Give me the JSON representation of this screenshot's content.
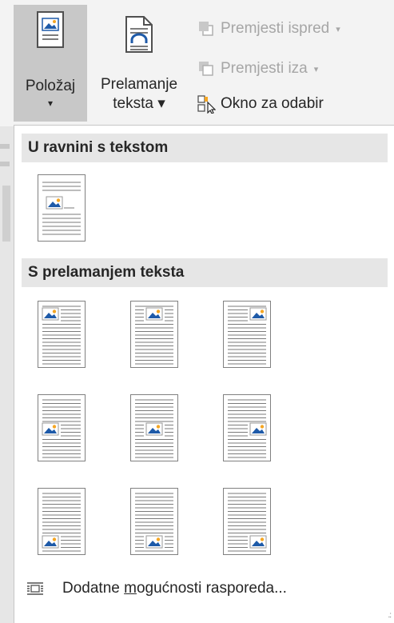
{
  "ribbon": {
    "position_button": {
      "line1": "Položaj",
      "line2": "▾"
    },
    "wrap_button": {
      "line1": "Prelamanje",
      "line2": "teksta ▾"
    },
    "bring_forward": {
      "label": "Premjesti ispred",
      "caret": "▾"
    },
    "send_backward": {
      "label": "Premjesti iza",
      "caret": "▾"
    },
    "selection_pane": {
      "label": "Okno za odabir"
    }
  },
  "dropdown": {
    "inline_header": "U ravnini s tekstom",
    "wrap_header": "S prelamanjem teksta",
    "footer_prefix": "Dodatne ",
    "footer_accel": "m",
    "footer_suffix": "ogućnosti rasporeda...",
    "grip": ".:"
  },
  "colors": {
    "ribbon_bg": "#f3f3f3",
    "selected_button_bg": "#c8c8c8",
    "section_header_bg": "#e6e6e6",
    "image_blue": "#1e5aa8",
    "image_sun": "#f5a623"
  },
  "icons": {
    "position": "position-icon",
    "wrap_text": "wrap-text-icon",
    "bring_forward": "bring-forward-icon",
    "send_backward": "send-backward-icon",
    "selection_pane": "selection-pane-icon",
    "layout_options": "layout-options-icon"
  }
}
